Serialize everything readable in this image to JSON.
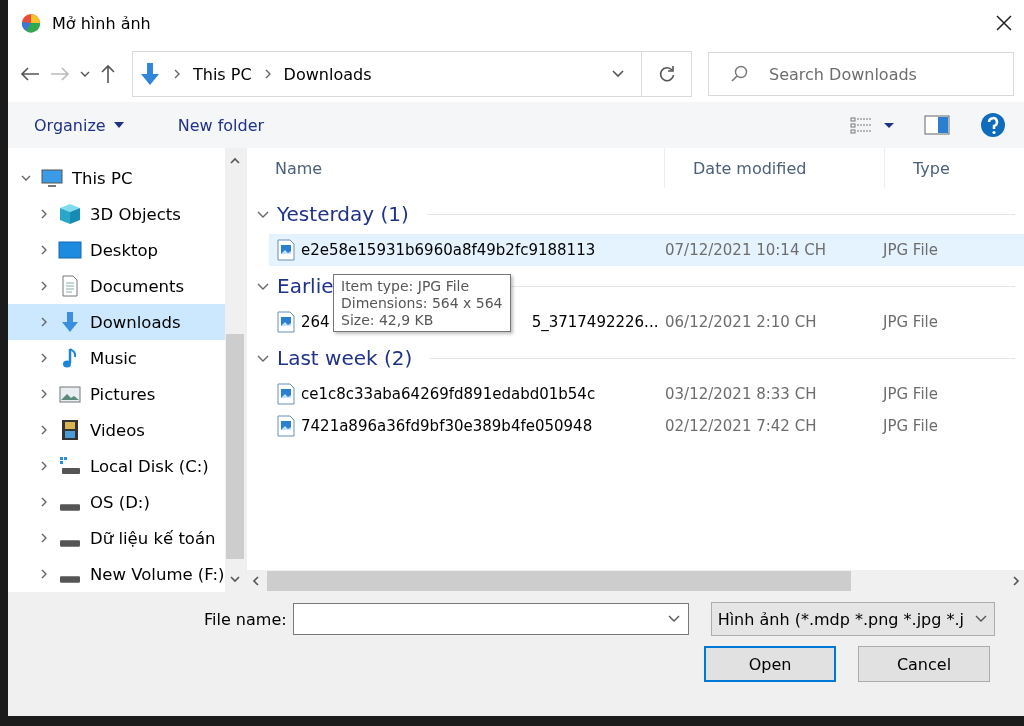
{
  "window": {
    "title": "Mở hình ảnh"
  },
  "address": {
    "path": [
      "This PC",
      "Downloads"
    ],
    "search_placeholder": "Search Downloads"
  },
  "toolbar": {
    "buttons": [
      "Organize",
      "New folder"
    ]
  },
  "nav_tree": [
    {
      "label": "This PC",
      "kind": "pc",
      "expanded": true,
      "selected": false,
      "children": [
        {
          "label": "3D Objects",
          "kind": "cube",
          "expanded": false,
          "selected": false
        },
        {
          "label": "Desktop",
          "kind": "desktop",
          "expanded": false,
          "selected": false
        },
        {
          "label": "Documents",
          "kind": "document",
          "expanded": false,
          "selected": false
        },
        {
          "label": "Downloads",
          "kind": "download",
          "expanded": false,
          "selected": true
        },
        {
          "label": "Music",
          "kind": "music",
          "expanded": false,
          "selected": false
        },
        {
          "label": "Pictures",
          "kind": "pictures",
          "expanded": false,
          "selected": false
        },
        {
          "label": "Videos",
          "kind": "videos",
          "expanded": false,
          "selected": false
        },
        {
          "label": "Local Disk (C:)",
          "kind": "system-disk",
          "expanded": false,
          "selected": false
        },
        {
          "label": "OS (D:)",
          "kind": "disk",
          "expanded": false,
          "selected": false
        },
        {
          "label": "Dữ liệu kế toán",
          "kind": "disk",
          "expanded": false,
          "selected": false
        },
        {
          "label": "New Volume (F:)",
          "kind": "disk",
          "expanded": false,
          "selected": false
        }
      ]
    }
  ],
  "table": {
    "columns": [
      "Name",
      "Date modified",
      "Type"
    ],
    "groups": [
      {
        "label": "Yesterday (1)",
        "expanded": true,
        "files": [
          {
            "name": "e2e58e15931b6960a8f49b2fc9188113",
            "date": "07/12/2021 10:14 CH",
            "type": "JPG File",
            "selected": true
          }
        ]
      },
      {
        "label": "Earlie",
        "expanded": true,
        "files": [
          {
            "name": "264",
            "name_tail": "5_3717492226...",
            "date": "06/12/2021 2:10 CH",
            "type": "JPG File",
            "selected": false
          }
        ]
      },
      {
        "label": "Last week (2)",
        "expanded": true,
        "files": [
          {
            "name": "ce1c8c33aba64269fd891edabd01b54c",
            "date": "03/12/2021 8:33 CH",
            "type": "JPG File",
            "selected": false
          },
          {
            "name": "7421a896a36fd9bf30e389b4fe050948",
            "date": "02/12/2021 7:42 CH",
            "type": "JPG File",
            "selected": false
          }
        ]
      }
    ]
  },
  "tooltip": {
    "lines": [
      "Item type: JPG File",
      "Dimensions: 564 x 564",
      "Size: 42,9 KB"
    ]
  },
  "footer": {
    "file_name_label": "File name:",
    "file_type": "Hình ảnh (*.mdp *.png *.jpg *.j",
    "buttons": [
      "Open",
      "Cancel"
    ]
  }
}
